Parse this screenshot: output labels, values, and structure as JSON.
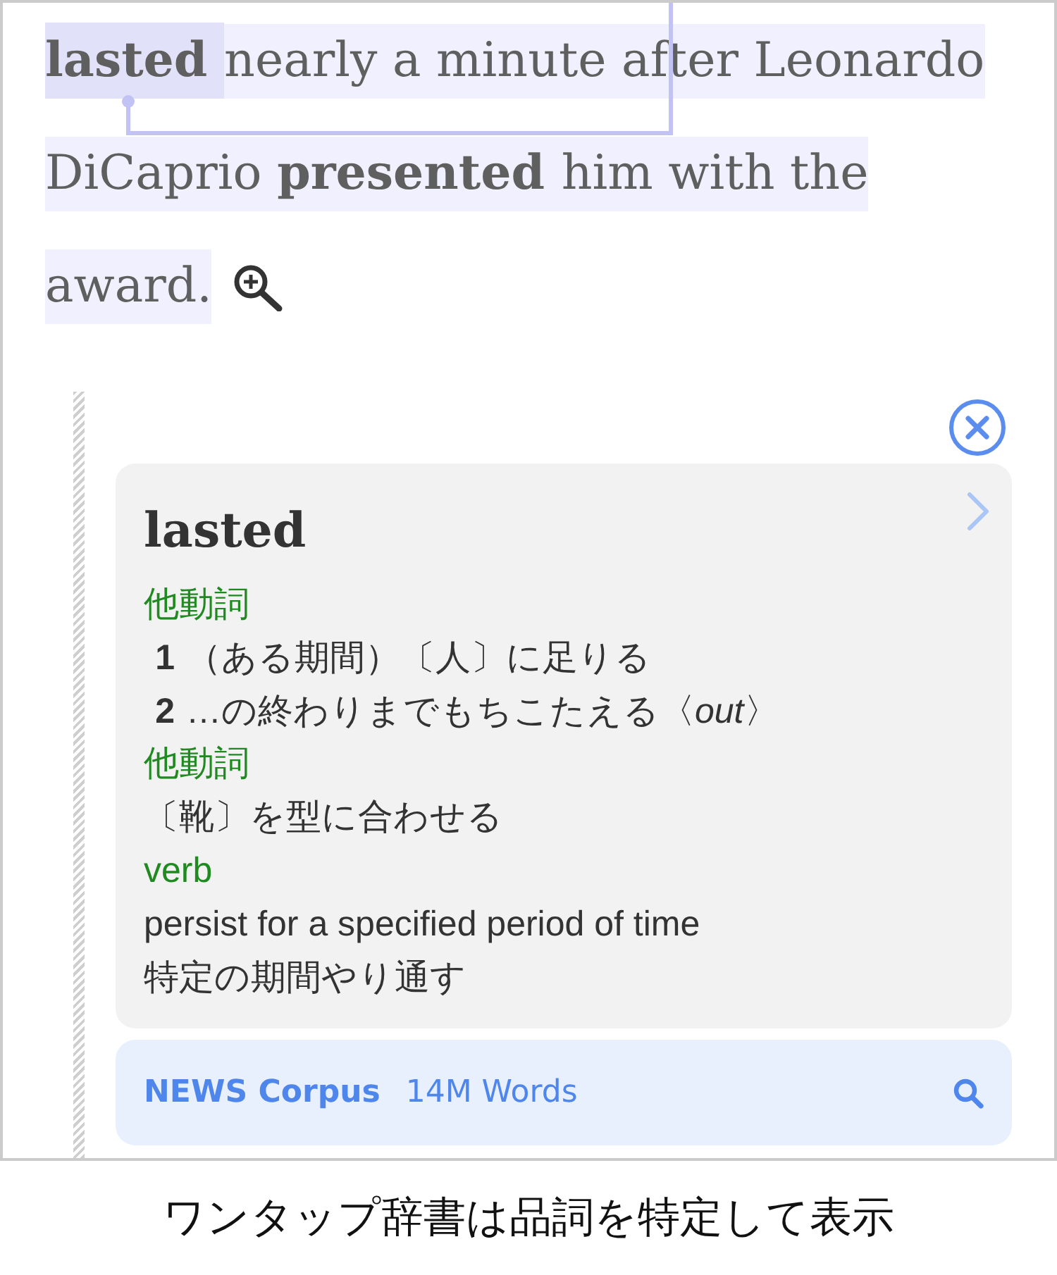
{
  "passage": {
    "lines": [
      {
        "segments": [
          {
            "kind": "keyword",
            "text": "lasted",
            "selected": true
          },
          {
            "kind": "plain",
            "text": "nearly a minute after Leonardo",
            "selected": false
          }
        ]
      },
      {
        "segments": [
          {
            "kind": "plain",
            "text": "DiCaprio",
            "selected": false
          },
          {
            "kind": "keyword",
            "text": "presented",
            "selected": false
          },
          {
            "kind": "plain",
            "text": "him with the",
            "selected": false
          }
        ]
      },
      {
        "segments": [
          {
            "kind": "plain",
            "text": "award.",
            "selected": false
          }
        ]
      }
    ]
  },
  "popup": {
    "headword": "lasted",
    "entries": [
      {
        "kind": "pos",
        "text": "他動詞"
      },
      {
        "kind": "sense",
        "number": "1",
        "text": "（ある期間）〔人〕に足りる"
      },
      {
        "kind": "sense",
        "number": "2",
        "text": "…の終わりまでもちこたえる〈*out*〉"
      },
      {
        "kind": "pos",
        "text": "他動詞"
      },
      {
        "kind": "gloss",
        "text": "〔靴〕を型に合わせる"
      },
      {
        "kind": "pos",
        "text": "verb"
      },
      {
        "kind": "gloss",
        "text": "persist for a specified period of time"
      },
      {
        "kind": "gloss",
        "text": "特定の期間やり通す"
      }
    ],
    "corpus": {
      "name": "NEWS Corpus",
      "size": "14M Words"
    }
  },
  "caption": "ワンタップ辞書は品詞を特定して表示"
}
